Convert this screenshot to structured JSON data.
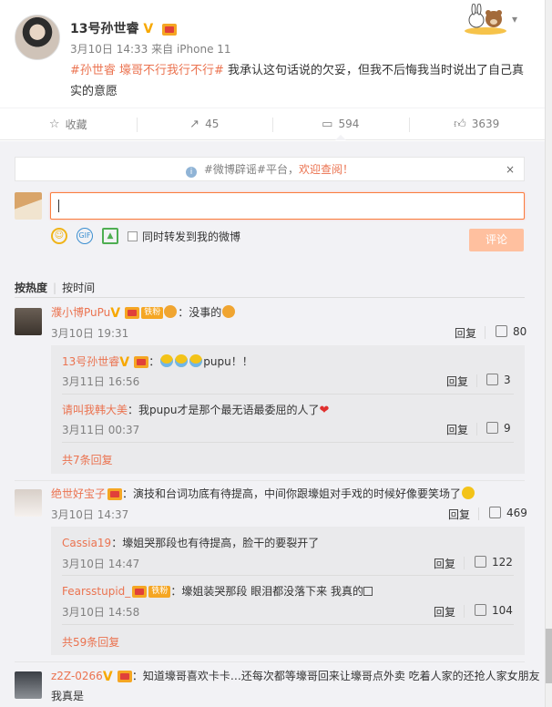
{
  "post": {
    "author": "13号孙世睿",
    "time": "3月10日 14:33",
    "source": "来自 iPhone 11",
    "hashtag": "#孙世睿 壕哥不行我行不行#",
    "text": " 我承认这句话说的欠妥，但我不后悔我当时说出了自己真实的意愿"
  },
  "actions": {
    "favorite": "收藏",
    "repost": "45",
    "comment": "594",
    "like": "3639"
  },
  "notice": {
    "tag1": "#微博辟谣#",
    "mid": "平台，",
    "link": "欢迎查阅！",
    "close": "×"
  },
  "composer": {
    "repost_label": "同时转发到我的微博",
    "submit": "评论"
  },
  "sort": {
    "hot": "按热度",
    "sep": "|",
    "time": "按时间"
  },
  "labels": {
    "reply": "回复",
    "fan": "铁粉"
  },
  "comments": [
    {
      "user": "濮小博PuPu",
      "text": "：没事的",
      "date": "3月10日 19:31",
      "likes": "80",
      "replies": [
        {
          "user": "13号孙世睿",
          "text": "pupu！！",
          "date": "3月11日 16:56",
          "likes": "3"
        },
        {
          "user": "请叫我韩大美",
          "text": "：我pupu才是那个最无语最委屈的人了",
          "date": "3月11日 00:37",
          "likes": "9"
        }
      ],
      "more": "共7条回复"
    },
    {
      "user": "绝世好宝子",
      "text": "：演技和台词功底有待提高，中间你跟壕姐对手戏的时候好像要笑场了",
      "date": "3月10日 14:37",
      "likes": "469",
      "replies": [
        {
          "user": "Cassia19",
          "text": "：壕姐哭那段也有待提高，脸干的要裂开了",
          "date": "3月10日 14:47",
          "likes": "122"
        },
        {
          "user": "Fearsstupid_",
          "text": "：壕姐装哭那段 眼泪都没落下来 我真的",
          "date": "3月10日 14:58",
          "likes": "104"
        }
      ],
      "more": "共59条回复"
    },
    {
      "user": "z2Z-0266",
      "text": "：知道壕哥喜欢卡卡…还每次都等壕哥回来让壕哥点外卖 吃着人家的还抢人家女朋友",
      "text2": "我真是"
    }
  ]
}
